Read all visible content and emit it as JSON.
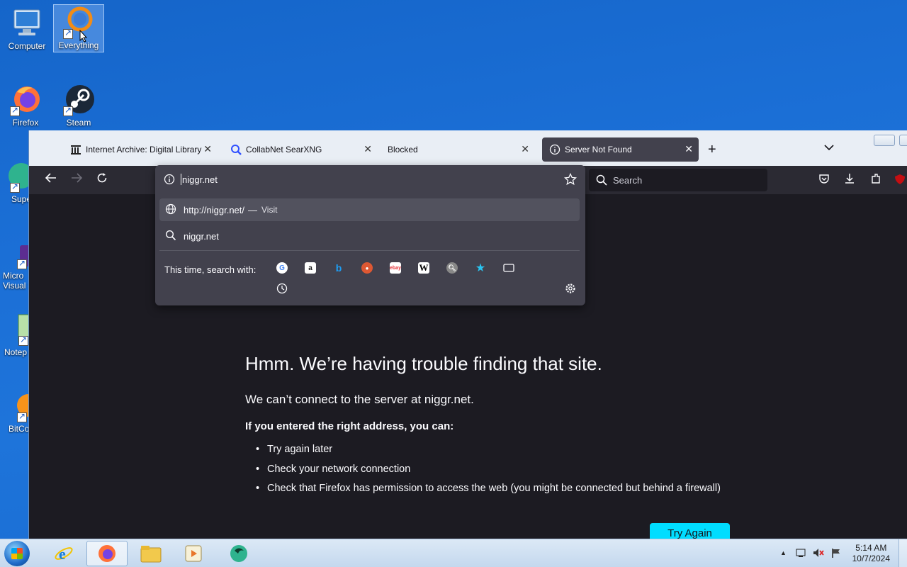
{
  "desktop": {
    "icons": [
      {
        "label": "Computer"
      },
      {
        "label": "Everything"
      },
      {
        "label": "Firefox"
      },
      {
        "label": "Steam"
      },
      {
        "label": "Super"
      },
      {
        "label": "Micro Visual S"
      },
      {
        "label": "Notep"
      },
      {
        "label": "BitCo"
      }
    ]
  },
  "browser": {
    "tabs": [
      {
        "title": "Internet Archive: Digital Library",
        "icon": "archive-icon"
      },
      {
        "title": "CollabNet SearXNG",
        "icon": "search-icon"
      },
      {
        "title": "Blocked",
        "icon": ""
      },
      {
        "title": "Server Not Found",
        "icon": "info-icon"
      }
    ],
    "search_placeholder": "Search",
    "url_value": "niggr.net"
  },
  "url_dropdown": {
    "suggestion_url": "http://niggr.net/",
    "suggestion_dash": "—",
    "suggestion_action": "Visit",
    "suggestion_search": "niggr.net",
    "engines_label": "This time, search with:",
    "engines": [
      "google",
      "amazon",
      "bing",
      "duckduckgo",
      "ebay",
      "wikipedia",
      "searxng",
      "bookmarks",
      "tabs",
      "history"
    ]
  },
  "error_page": {
    "title": "Hmm. We’re having trouble finding that site.",
    "subtitle": "We can’t connect to the server at niggr.net.",
    "lead": "If you entered the right address, you can:",
    "items": [
      "Try again later",
      "Check your network connection",
      "Check that Firefox has permission to access the web (you might be connected but behind a firewall)"
    ],
    "retry_label": "Try Again",
    "accent": "#00ddff"
  },
  "taskbar": {
    "time": "5:14 AM",
    "date": "10/7/2024"
  }
}
